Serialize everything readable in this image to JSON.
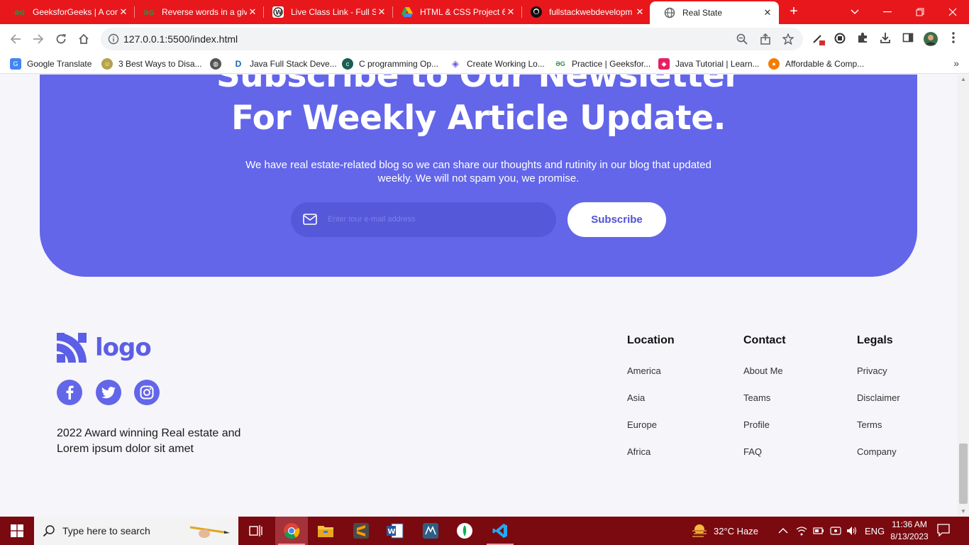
{
  "browser": {
    "tabs": [
      {
        "title": "GeeksforGeeks | A com",
        "favicon": "gfg-icon"
      },
      {
        "title": "Reverse words in a giv",
        "favicon": "gfg-icon"
      },
      {
        "title": "Live Class Link - Full St",
        "favicon": "wordpress-icon"
      },
      {
        "title": "HTML & CSS Project 6",
        "favicon": "google-drive-icon"
      },
      {
        "title": "fullstackwebdevelopm",
        "favicon": "github-icon"
      },
      {
        "title": "Real State",
        "favicon": "globe-icon"
      }
    ],
    "url": "127.0.0.1:5500/index.html",
    "bookmarks": [
      {
        "label": "Google Translate"
      },
      {
        "label": "3 Best Ways to Disa..."
      },
      {
        "label": ""
      },
      {
        "label": "Java Full Stack Deve..."
      },
      {
        "label": "C programming Op..."
      },
      {
        "label": "Create Working Lo..."
      },
      {
        "label": "Practice | Geeksfor..."
      },
      {
        "label": "Java Tutorial | Learn..."
      },
      {
        "label": "Affordable & Comp..."
      }
    ],
    "colors": {
      "tabstrip": "#e8171c",
      "taskbar": "#7a0a10"
    }
  },
  "page": {
    "newsletter": {
      "heading_line1": "Subscribe to Our Newsletter",
      "heading_line2": "For Weekly Article Update.",
      "description": "We have real estate-related blog so we can share our thoughts and rutinity in our blog that updated weekly. We will not spam you, we promise.",
      "email_placeholder": "Enter tour e-mail address",
      "subscribe_label": "Subscribe",
      "accent_color": "#6366e9"
    },
    "footer": {
      "logo_text": "logo",
      "tagline": "2022 Award winning Real estate and Lorem ipsum dolor sit amet",
      "social": [
        "facebook-icon",
        "twitter-icon",
        "instagram-icon"
      ],
      "columns": [
        {
          "title": "Location",
          "links": [
            "America",
            "Asia",
            "Europe",
            "Africa"
          ]
        },
        {
          "title": "Contact",
          "links": [
            "About Me",
            "Teams",
            "Profile",
            "FAQ"
          ]
        },
        {
          "title": "Legals",
          "links": [
            "Privacy",
            "Disclaimer",
            "Terms",
            "Company"
          ]
        }
      ]
    }
  },
  "taskbar": {
    "search_placeholder": "Type here to search",
    "weather": "32°C  Haze",
    "language": "ENG",
    "time": "11:36 AM",
    "date": "8/13/2023"
  }
}
